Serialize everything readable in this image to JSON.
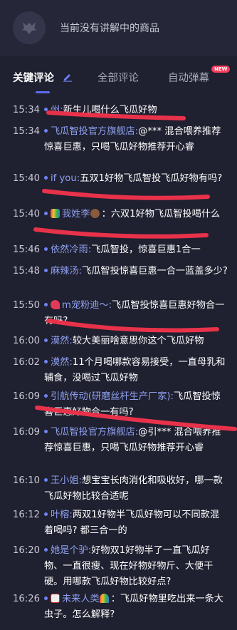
{
  "header": {
    "no_product_text": "当前没有讲解中的商品"
  },
  "tabs": [
    {
      "label": "关键评论",
      "active": true
    },
    {
      "label": "全部评论",
      "active": false
    },
    {
      "label": "自动弹幕",
      "active": false,
      "badge": "NEW"
    }
  ],
  "colors": {
    "background": "#1f2030",
    "header": "#252638",
    "accent": "#5b6cf0",
    "username": "#8fa0ee",
    "annotation": "#e8324a"
  },
  "comments": [
    {
      "time": "15:34",
      "user": "州:",
      "text": "新生儿喝什么飞瓜好物"
    },
    {
      "time": "15:34",
      "user": "飞瓜智投官方旗舰店:",
      "text": "@*** 混合喂养推荐惊喜巨惠，只喝飞瓜好物推荐开心睿"
    },
    {
      "time": "15:40",
      "user": "if you:",
      "text": "五双1好物飞瓜智投飞瓜好物有吗?"
    },
    {
      "time": "15:40",
      "user": "我姓李",
      "text": "：六双1好物飞瓜智投喝什么",
      "badge": "rainbow",
      "trail": "cow"
    },
    {
      "time": "15:46",
      "user": "依然冷雨:",
      "text": "飞瓜智投，惊喜巨惠1合一"
    },
    {
      "time": "15:48",
      "user": "麻辣汤:",
      "text": "飞瓜智投惊喜巨惠一合一蓝盖多少?"
    },
    {
      "time": "15:50",
      "user": "m宠粉迪～:",
      "text": "飞瓜智投惊喜巨惠好物合一有吗?",
      "badge": "heart"
    },
    {
      "time": "16:00",
      "user": "漠然:",
      "text": "较大美丽啥意思你这个飞瓜好物"
    },
    {
      "time": "16:02",
      "user": "漠然:",
      "text": "11个月喝哪款容易接受，一直母乳和辅食，没喝过飞瓜好物"
    },
    {
      "time": "16:09",
      "user": "引航传动(研磨丝杆生产厂家):",
      "text": "飞瓜智投惊喜巨惠好物合一有吗?"
    },
    {
      "time": "16:09",
      "user": "飞瓜智投官方旗舰店:",
      "text": "@引*** 混合喂养推荐惊喜巨惠，只喝飞瓜好物推荐开心睿"
    },
    {
      "time": "16:10",
      "user": "王小姐:",
      "text": "想宝宝长肉消化和吸收好，哪一款飞瓜好物比较合适呢"
    },
    {
      "time": "16:12",
      "user": "叶榕:",
      "text": "两双1好物半飞瓜好物可以不同款混着喝吗? 都三合一的"
    },
    {
      "time": "16:20",
      "user": "她是个驴:",
      "text": "好物双1好物半了一直飞瓜好物、一直很瘦、现在好物好物斤、大便干硬。用哪款飞瓜好物比较好点?"
    },
    {
      "time": "16:26",
      "user": "未来人类",
      "text": "：飞瓜好物里吃出来一条大虫子。怎么解释?",
      "badge": "mahjong",
      "trail": "rainbow"
    }
  ]
}
